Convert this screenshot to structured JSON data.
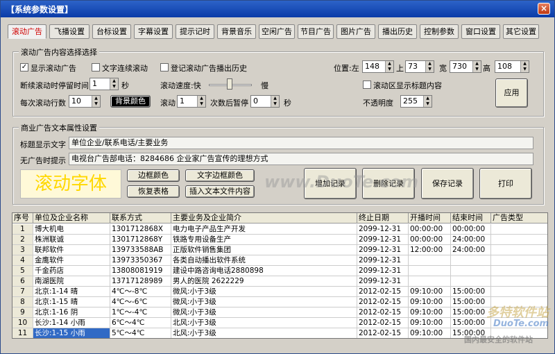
{
  "window": {
    "title": "【系统参数设置】",
    "close_label": "×"
  },
  "tabs": [
    "滚动广告",
    "飞播设置",
    "台标设置",
    "字幕设置",
    "提示记时",
    "背景音乐",
    "空闲广告",
    "节目广告",
    "图片广告",
    "播出历史",
    "控制参数",
    "窗口设置",
    "其它设置"
  ],
  "scroll_group": {
    "title": "滚动广告内容选择选择",
    "show_scroll_ad": {
      "label": "显示滚动广告",
      "checked": true
    },
    "text_continuous": {
      "label": "文字连续滚动",
      "checked": false
    },
    "log_history": {
      "label": "登记滚动广告播出历史",
      "checked": false
    },
    "position_label": "位置:左",
    "left": "148",
    "top_label": "上",
    "top": "73",
    "width_label": "宽",
    "width": "730",
    "height_label": "高",
    "height": "108",
    "pause_label": "断续滚动时停留时间",
    "pause_value": "1",
    "pause_unit": "秒",
    "speed_label": "滚动速度:快",
    "speed_slow": "慢",
    "show_title": {
      "label": "滚动区显示标题内容",
      "checked": false
    },
    "apply_label": "应用",
    "lines_label": "每次滚动行数",
    "lines_value": "10",
    "bg_color_label": "背景颜色",
    "scroll_label": "滚动",
    "scroll_value": "1",
    "times_label": "次数后暂停",
    "times_value": "0",
    "times_unit": "秒",
    "opacity_label": "不透明度",
    "opacity_value": "255"
  },
  "text_group": {
    "title": "商业广告文本属性设置",
    "title_text_label": "标题显示文字",
    "title_text_value": "单位企业/联系电话/主要业务",
    "noad_label": "无广告时提示",
    "noad_value": "电视台广告部电话：8284686  企业家广告宣传的理想方式",
    "preview_text": "滚动字体",
    "border_color": "边框颜色",
    "text_border_color": "文字边框颜色",
    "restore_table": "恢复表格",
    "insert_text": "插入文本文件内容",
    "add_record": "增加记录",
    "delete_record": "删除记录",
    "save_record": "保存记录",
    "print": "打印"
  },
  "table": {
    "headers": [
      "序号",
      "单位及企业名称",
      "联系方式",
      "主要业务及企业简介",
      "终止日期",
      "开播时间",
      "结束时间",
      "广告类型"
    ],
    "rows": [
      [
        "1",
        "博大机电",
        "1301712868X",
        "电力电子产品生产开发",
        "2099-12-31",
        "00:00:00",
        "00:00:00",
        ""
      ],
      [
        "2",
        "株洲联诚",
        "1301712868Y",
        "铁路专用设备生产",
        "2099-12-31",
        "00:00:00",
        "24:00:00",
        ""
      ],
      [
        "3",
        "联邦软件",
        "139733588AB",
        "正版软件销售集团",
        "2099-12-31",
        "12:00:00",
        "24:00:00",
        ""
      ],
      [
        "4",
        "金鹰软件",
        "13973350367",
        "各类自动播出软件系统",
        "2099-12-31",
        "",
        "",
        " "
      ],
      [
        "5",
        "千金药店",
        "13808081919",
        "建设中路咨询电话2880898",
        "2099-12-31",
        "",
        "",
        ""
      ],
      [
        "6",
        "南湖医院",
        "13717128989",
        "男人的医院 2622229",
        "2099-12-31",
        "",
        "",
        ""
      ],
      [
        "7",
        "北京:1-14 晴",
        "4℃～-8℃",
        "微风:小于3级",
        "2012-02-15",
        "09:10:00",
        "15:00:00",
        ""
      ],
      [
        "8",
        "北京:1-15 晴",
        "4℃～-6℃",
        "微风:小于3级",
        "2012-02-15",
        "09:10:00",
        "15:00:00",
        ""
      ],
      [
        "9",
        "北京:1-16 阴",
        "1℃～-4℃",
        "微风:小于3级",
        "2012-02-15",
        "09:10:00",
        "15:00:00",
        ""
      ],
      [
        "10",
        "长沙:1-14 小雨",
        "6℃～4℃",
        "北风:小于3级",
        "2012-02-15",
        "09:10:00",
        "15:00:00",
        ""
      ],
      [
        "11",
        "长沙:1-15 小雨",
        "5℃～4℃",
        "北风:小于3级",
        "2012-02-15",
        "09:10:00",
        "15:00:00",
        ""
      ]
    ]
  },
  "watermarks": {
    "center": "www.DuoTe.com",
    "logo": "多特软件站",
    "logo_url": "DuoTe.com",
    "logo_slogan": "国内最安全的软件站"
  }
}
